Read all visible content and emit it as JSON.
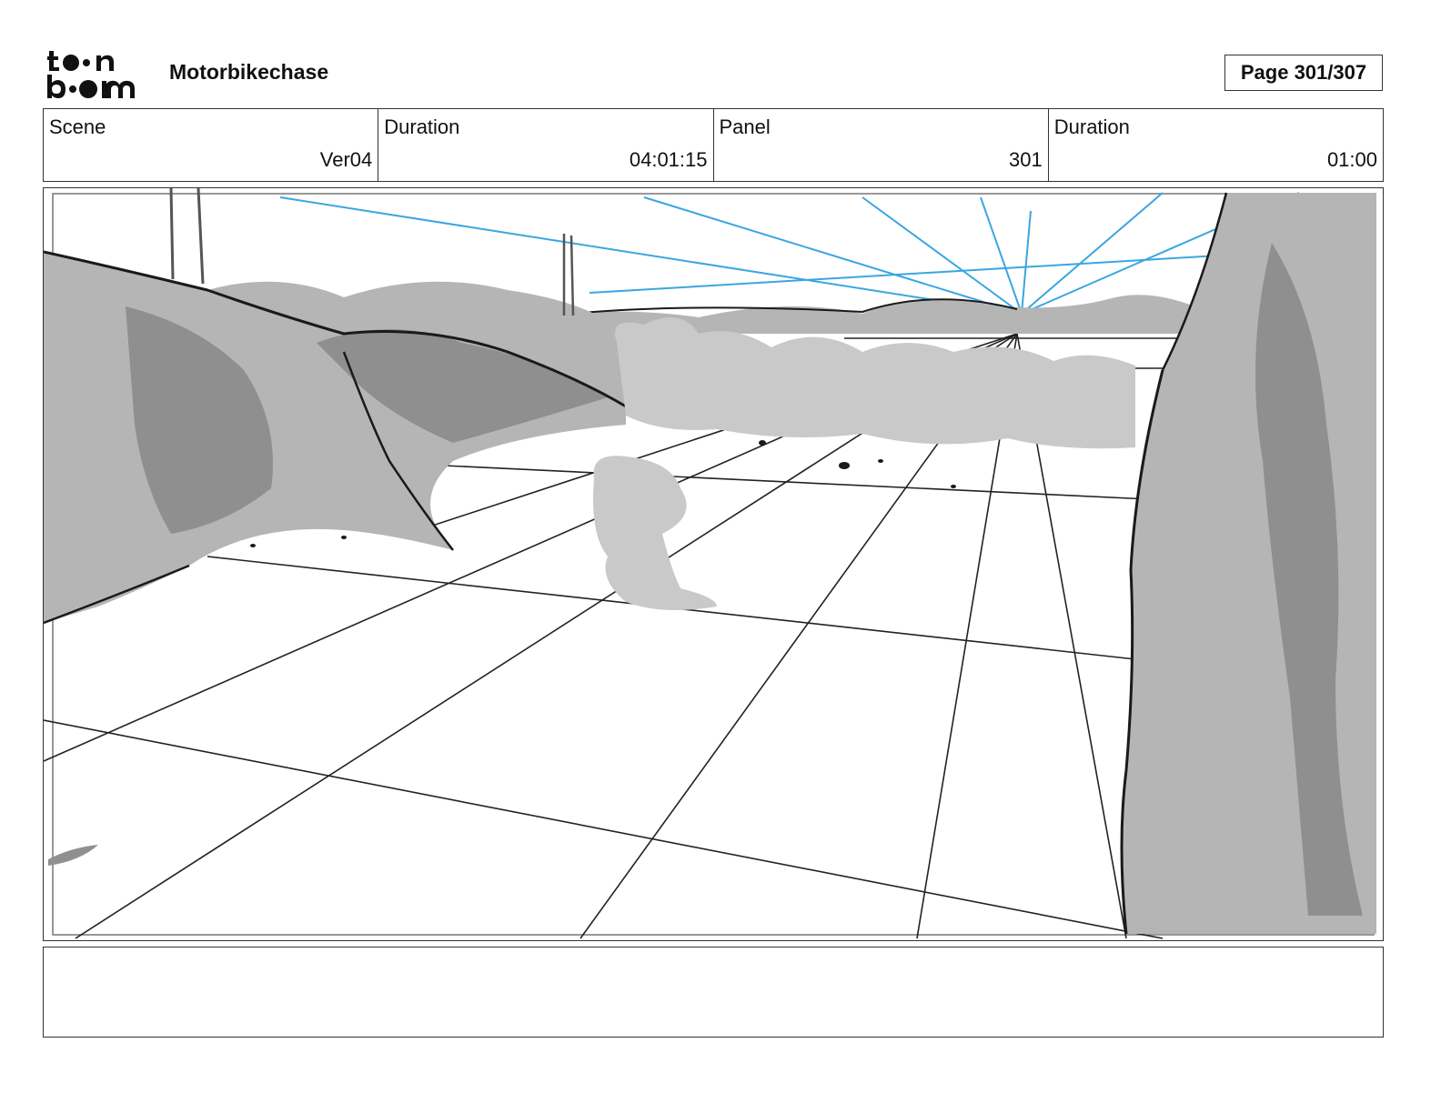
{
  "header": {
    "logo_text": "toon boom",
    "project_title": "Motorbikechase",
    "page_label": "Page 301/307"
  },
  "info": [
    {
      "label": "Scene",
      "value": "Ver04"
    },
    {
      "label": "Duration",
      "value": "04:01:15"
    },
    {
      "label": "Panel",
      "value": "301"
    },
    {
      "label": "Duration",
      "value": "01:00"
    }
  ],
  "panel": {
    "illustration": "storyboard-sketch",
    "colors": {
      "guide_lines": "#3aa6e0",
      "rock_light": "#b5b5b5",
      "rock_dark": "#8f8f8f",
      "dust": "#c9c9c9",
      "ink": "#1a1a1a"
    }
  },
  "notes": {
    "text": ""
  }
}
